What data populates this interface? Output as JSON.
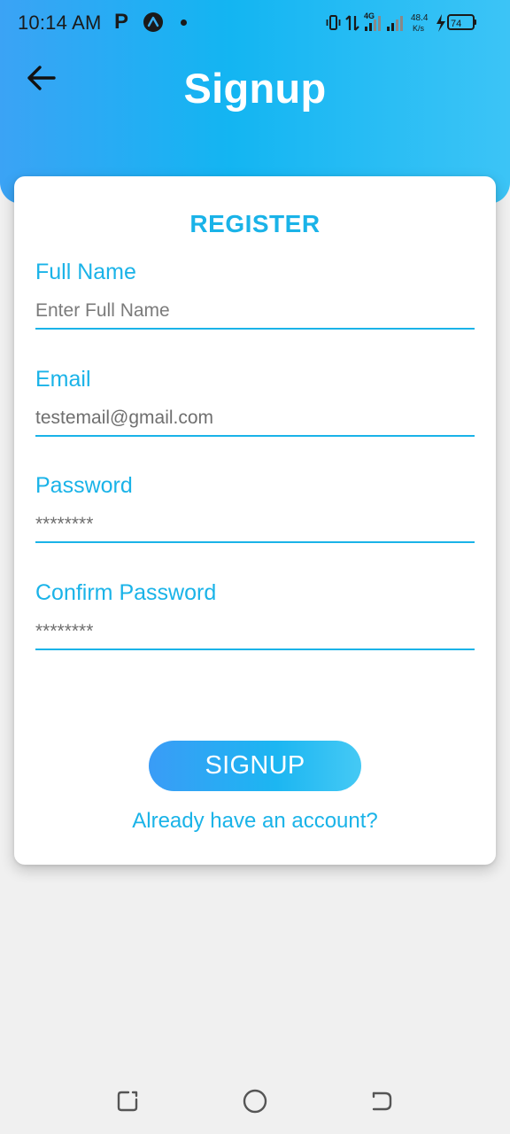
{
  "status_bar": {
    "time": "10:14 AM",
    "notification_letter": "P",
    "network_type": "4G",
    "speed_value": "48.4",
    "speed_unit": "K/s",
    "battery": "74"
  },
  "header": {
    "title": "Signup"
  },
  "form": {
    "heading": "REGISTER",
    "fields": [
      {
        "label": "Full Name",
        "value": "",
        "placeholder": "Enter Full Name"
      },
      {
        "label": "Email",
        "value": "testemail@gmail.com",
        "placeholder": ""
      },
      {
        "label": "Password",
        "value": "********",
        "placeholder": ""
      },
      {
        "label": "Confirm Password",
        "value": "********",
        "placeholder": ""
      }
    ],
    "submit_label": "SIGNUP",
    "login_link": "Already have an account?"
  },
  "colors": {
    "accent": "#1ab3e8",
    "header_gradient_start": "#3ba3f5",
    "header_gradient_end": "#3cc4f6",
    "background": "#f0f0f0",
    "card": "#ffffff"
  },
  "icons": {
    "back": "arrow-left-icon",
    "nav_recent": "recent-apps-icon",
    "nav_home": "home-circle-icon",
    "nav_back": "system-back-icon"
  }
}
